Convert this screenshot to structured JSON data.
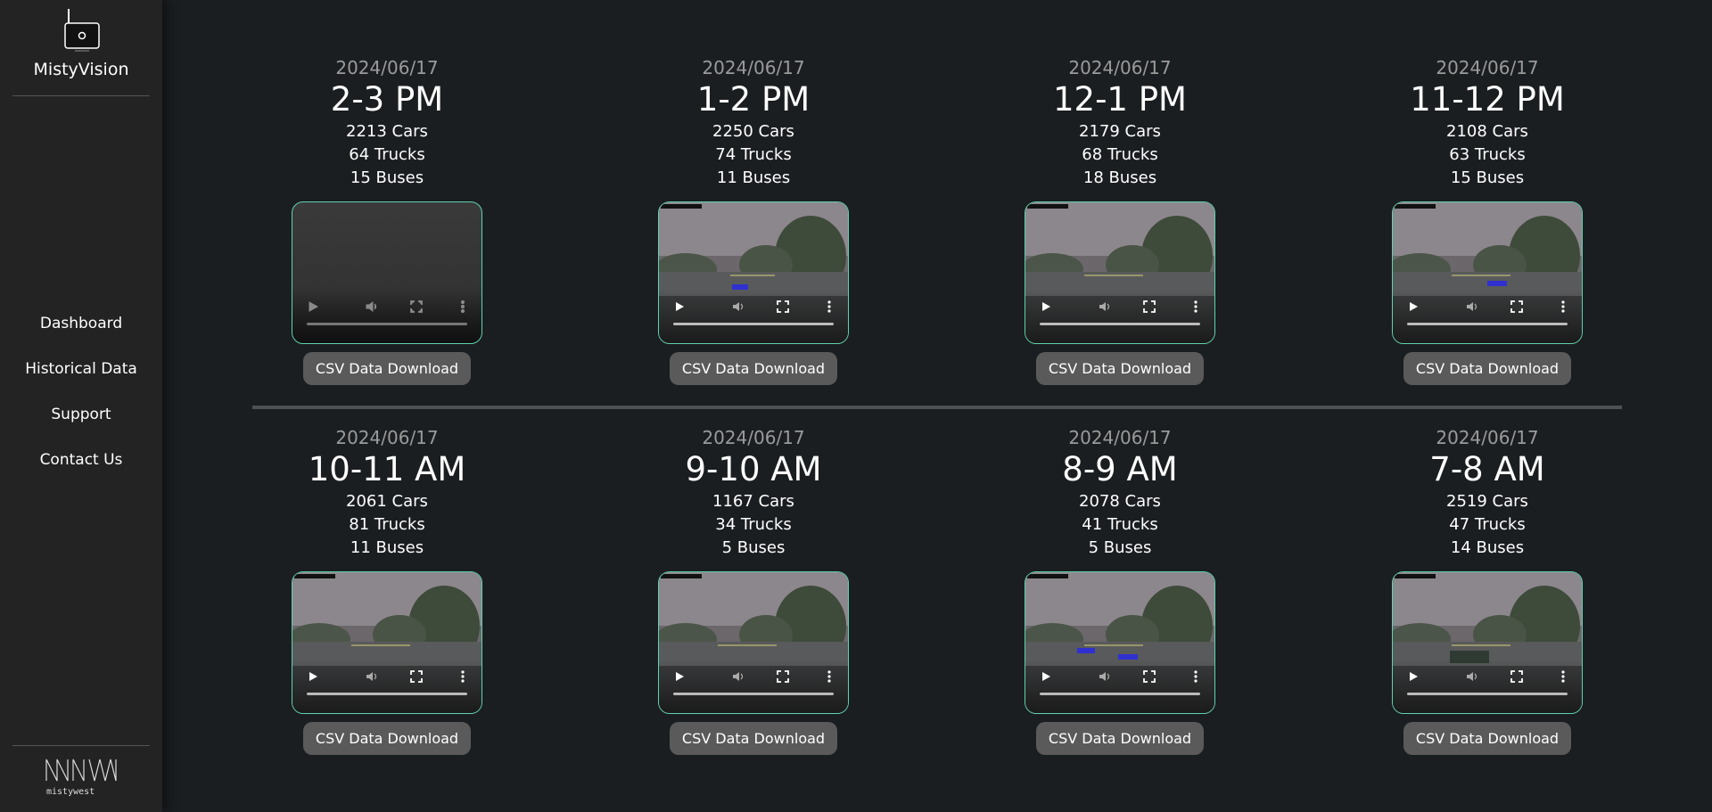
{
  "sidebar": {
    "brand": "MistyVision",
    "nav": [
      "Dashboard",
      "Historical Data",
      "Support",
      "Contact Us"
    ],
    "footer_logo_text": "mistywest"
  },
  "cards": [
    {
      "date": "2024/06/17",
      "time": "2-3 PM",
      "cars": "2213 Cars",
      "trucks": "64 Trucks",
      "buses": "15 Buses",
      "button": "CSV Data Download",
      "video_loaded": false
    },
    {
      "date": "2024/06/17",
      "time": "1-2 PM",
      "cars": "2250 Cars",
      "trucks": "74 Trucks",
      "buses": "11 Buses",
      "button": "CSV Data Download",
      "video_loaded": true
    },
    {
      "date": "2024/06/17",
      "time": "12-1 PM",
      "cars": "2179 Cars",
      "trucks": "68 Trucks",
      "buses": "18 Buses",
      "button": "CSV Data Download",
      "video_loaded": true
    },
    {
      "date": "2024/06/17",
      "time": "11-12 PM",
      "cars": "2108 Cars",
      "trucks": "63 Trucks",
      "buses": "15 Buses",
      "button": "CSV Data Download",
      "video_loaded": true
    },
    {
      "date": "2024/06/17",
      "time": "10-11 AM",
      "cars": "2061 Cars",
      "trucks": "81 Trucks",
      "buses": "11 Buses",
      "button": "CSV Data Download",
      "video_loaded": true
    },
    {
      "date": "2024/06/17",
      "time": "9-10 AM",
      "cars": "1167 Cars",
      "trucks": "34 Trucks",
      "buses": "5 Buses",
      "button": "CSV Data Download",
      "video_loaded": true
    },
    {
      "date": "2024/06/17",
      "time": "8-9 AM",
      "cars": "2078 Cars",
      "trucks": "41 Trucks",
      "buses": "5 Buses",
      "button": "CSV Data Download",
      "video_loaded": true
    },
    {
      "date": "2024/06/17",
      "time": "7-8 AM",
      "cars": "2519 Cars",
      "trucks": "47 Trucks",
      "buses": "14 Buses",
      "button": "CSV Data Download",
      "video_loaded": true
    }
  ],
  "colors": {
    "background": "#1b1e21",
    "sidebar": "#232323",
    "video_border": "#5fd3b0",
    "button_bg": "#5a5a5a",
    "date_text": "#9a9a9a"
  }
}
